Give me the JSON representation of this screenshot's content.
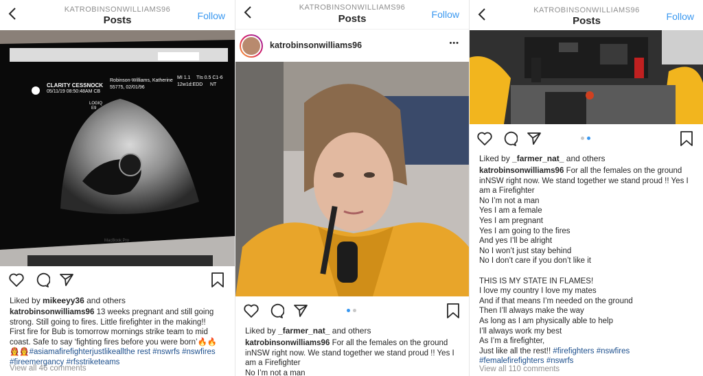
{
  "panel1": {
    "header": {
      "username": "KATROBINSONWILLIAMS96",
      "title": "Posts",
      "follow": "Follow"
    },
    "screen_text": {
      "clinic": "CLARITY CESSNOCK",
      "datetime": "05/11/19 08:50:48AM CB",
      "patient": "Robinson-Williams, Katherine",
      "patient_id": "55775, 02/01/96",
      "mi": "MI 1.1",
      "tis": "TIs 0.5 C1-6",
      "edd": "12w1d:EDD",
      "nt": "NT",
      "logiq": "LOGIQ",
      "e9": "E9",
      "macbook": "MacBook Pro"
    },
    "liked_prefix": "Liked by",
    "liked_user": "mikeeyy36",
    "liked_suffix": "and others",
    "caption_user": "katrobinsonwilliams96",
    "caption_lines": [
      "13 weeks pregnant and still going",
      "strong. Still going to fires.  Little firefighter in the making!!",
      "First fire for Bub is tomorrow mornings strike team to mid",
      "coast. Safe to say ‘fighting fires before you were born’🔥🔥",
      "👩‍🚒👩‍🚒"
    ],
    "hashtags": [
      "#asiamafirefighterjustlikeallthe rest",
      "#nswrfs",
      "#nswfires",
      "#fireemergancy",
      "#rfsstriketeams"
    ],
    "view_all": "View all 46 comments"
  },
  "panel2": {
    "header": {
      "username": "KATROBINSONWILLIAMS96",
      "title": "Posts",
      "follow": "Follow"
    },
    "post_user": "katrobinsonwilliams96",
    "more": "•••",
    "liked_prefix": "Liked by",
    "liked_user": "_farmer_nat_",
    "liked_suffix": "and others",
    "caption_user": "katrobinsonwilliams96",
    "caption_lines": [
      "For all the females on the ground",
      "inNSW right now. We stand together we stand proud !! Yes I",
      "am a Firefighter",
      "No I’m not a man"
    ]
  },
  "panel3": {
    "header": {
      "username": "KATROBINSONWILLIAMS96",
      "title": "Posts",
      "follow": "Follow"
    },
    "liked_prefix": "Liked by",
    "liked_user": "_farmer_nat_",
    "liked_suffix": "and others",
    "caption_user": "katrobinsonwilliams96",
    "caption_first": "For all the females on the ground",
    "caption_lines": [
      "inNSW right now. We stand together we stand proud !! Yes I",
      "am a Firefighter",
      "No I’m not a man",
      "Yes I am a female",
      "Yes I am pregnant",
      "Yes I am going to the fires",
      "And yes I’ll be alright",
      "No I won’t just stay behind",
      "No I don’t care if you don’t like it",
      "",
      "THIS IS MY STATE IN FLAMES!",
      "I love my country I love my mates",
      "And if that means I’m needed on the ground",
      "Then I’ll always make the way",
      "As long as I am physically able to help",
      "I’ll always work my best",
      "As I’m a firefighter,"
    ],
    "last_line_text": "Just like all the rest!!",
    "last_line_tags": [
      "#firefighters",
      "#nswfires"
    ],
    "final_tags": [
      "#femalefirefighters",
      "#nswrfs"
    ],
    "view_all": "View all 110 comments"
  },
  "colors": {
    "link": "#3897f0",
    "hashtag": "#1b4e8c",
    "muted": "#8e8e8e"
  }
}
